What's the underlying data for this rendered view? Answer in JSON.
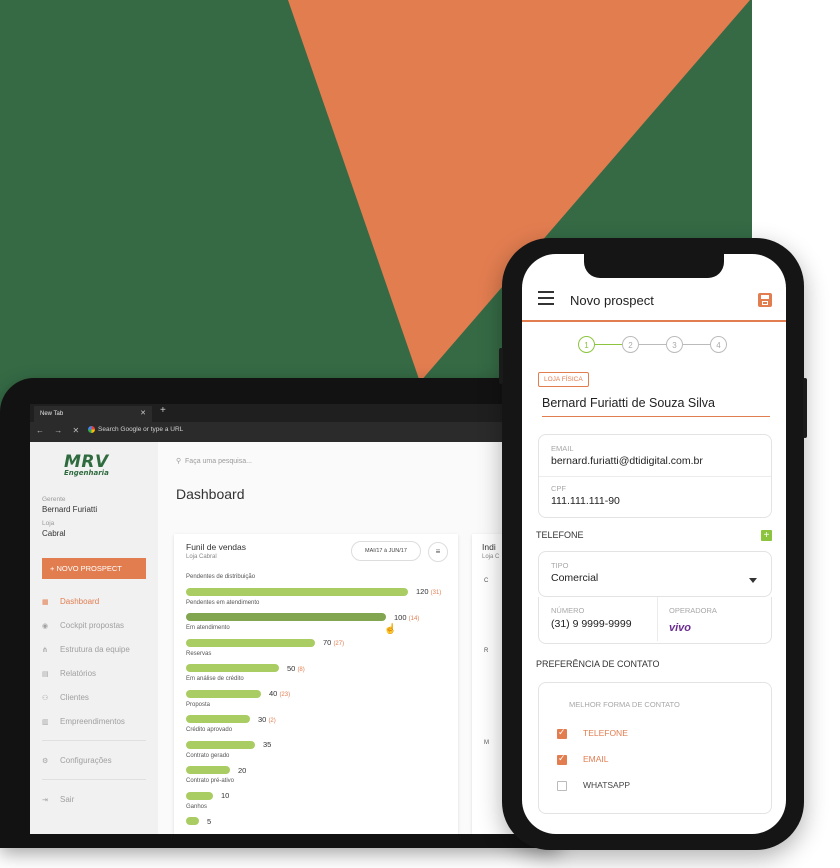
{
  "colors": {
    "green_bg": "#356a45",
    "orange": "#e27d50",
    "bar_green": "#a9cd62",
    "step_green": "#8cc43f"
  },
  "browser": {
    "tab_title": "New Tab",
    "address": "Search Google or type a URL"
  },
  "sidebar": {
    "logo_main": "MRV",
    "logo_sub": "Engenharia",
    "gerente_label": "Gerente",
    "gerente_value": "Bernard Furiatti",
    "loja_label": "Loja",
    "loja_value": "Cabral",
    "new_button": "+  NOVO PROSPECT",
    "items": [
      {
        "label": "Dashboard",
        "icon": "grid-icon"
      },
      {
        "label": "Cockpit propostas",
        "icon": "gauge-icon"
      },
      {
        "label": "Estrutura da equipe",
        "icon": "hierarchy-icon"
      },
      {
        "label": "Relatórios",
        "icon": "document-icon"
      },
      {
        "label": "Clientes",
        "icon": "people-icon"
      },
      {
        "label": "Empreendimentos",
        "icon": "building-icon"
      },
      {
        "label": "Configurações",
        "icon": "gear-icon"
      },
      {
        "label": "Sair",
        "icon": "exit-icon"
      }
    ]
  },
  "main": {
    "search_placeholder": "Faça uma pesquisa...",
    "title": "Dashboard",
    "funnel": {
      "title": "Funil de vendas",
      "subtitle": "Loja Cabral",
      "date_range": "MAI/17 à JUN/17",
      "rows": [
        {
          "label": "Pendentes de distribuição",
          "value": "120",
          "sub": "(31)",
          "fraction": 1.0
        },
        {
          "label": "Pendentes em atendimento",
          "value": "100",
          "sub": "(14)",
          "fraction": 0.9
        },
        {
          "label": "Em atendimento",
          "value": "70",
          "sub": "(27)",
          "fraction": 0.58
        },
        {
          "label": "Reservas",
          "value": "50",
          "sub": "(8)",
          "fraction": 0.42
        },
        {
          "label": "Em análise de crédito",
          "value": "40",
          "sub": "(23)",
          "fraction": 0.34
        },
        {
          "label": "Proposta",
          "value": "30",
          "sub": "(2)",
          "fraction": 0.29
        },
        {
          "label": "Crédito aprovado",
          "value": "35",
          "sub": "",
          "fraction": 0.31
        },
        {
          "label": "Contrato gerado",
          "value": "20",
          "sub": "",
          "fraction": 0.2
        },
        {
          "label": "Contrato pré-ativo",
          "value": "10",
          "sub": "",
          "fraction": 0.12
        },
        {
          "label": "Ganhos",
          "value": "5",
          "sub": "",
          "fraction": 0.06
        }
      ]
    },
    "card2": {
      "title": "Indi",
      "subtitle": "Loja C",
      "marks": [
        "C",
        "R",
        "M"
      ]
    }
  },
  "phone": {
    "title": "Novo prospect",
    "steps": [
      "1",
      "2",
      "3",
      "4"
    ],
    "chip": "LOJA FÍSICA",
    "name": "Bernard Furiatti de Souza Silva",
    "email_label": "EMAIL",
    "email_value": "bernard.furiatti@dtidigital.com.br",
    "cpf_label": "CPF",
    "cpf_value": "111.111.111-90",
    "telefone_section": "TELEFONE",
    "tipo_label": "TIPO",
    "tipo_value": "Comercial",
    "numero_label": "NÚMERO",
    "numero_value": "(31) 9 9999-9999",
    "operadora_label": "OPERADORA",
    "operadora_value": "vivo",
    "pref_section": "PREFERÊNCIA DE CONTATO",
    "melhor_forma_label": "MELHOR FORMA DE CONTATO",
    "options": [
      {
        "label": "TELEFONE",
        "checked": true
      },
      {
        "label": "EMAIL",
        "checked": true
      },
      {
        "label": "WHATSAPP",
        "checked": false
      }
    ]
  }
}
